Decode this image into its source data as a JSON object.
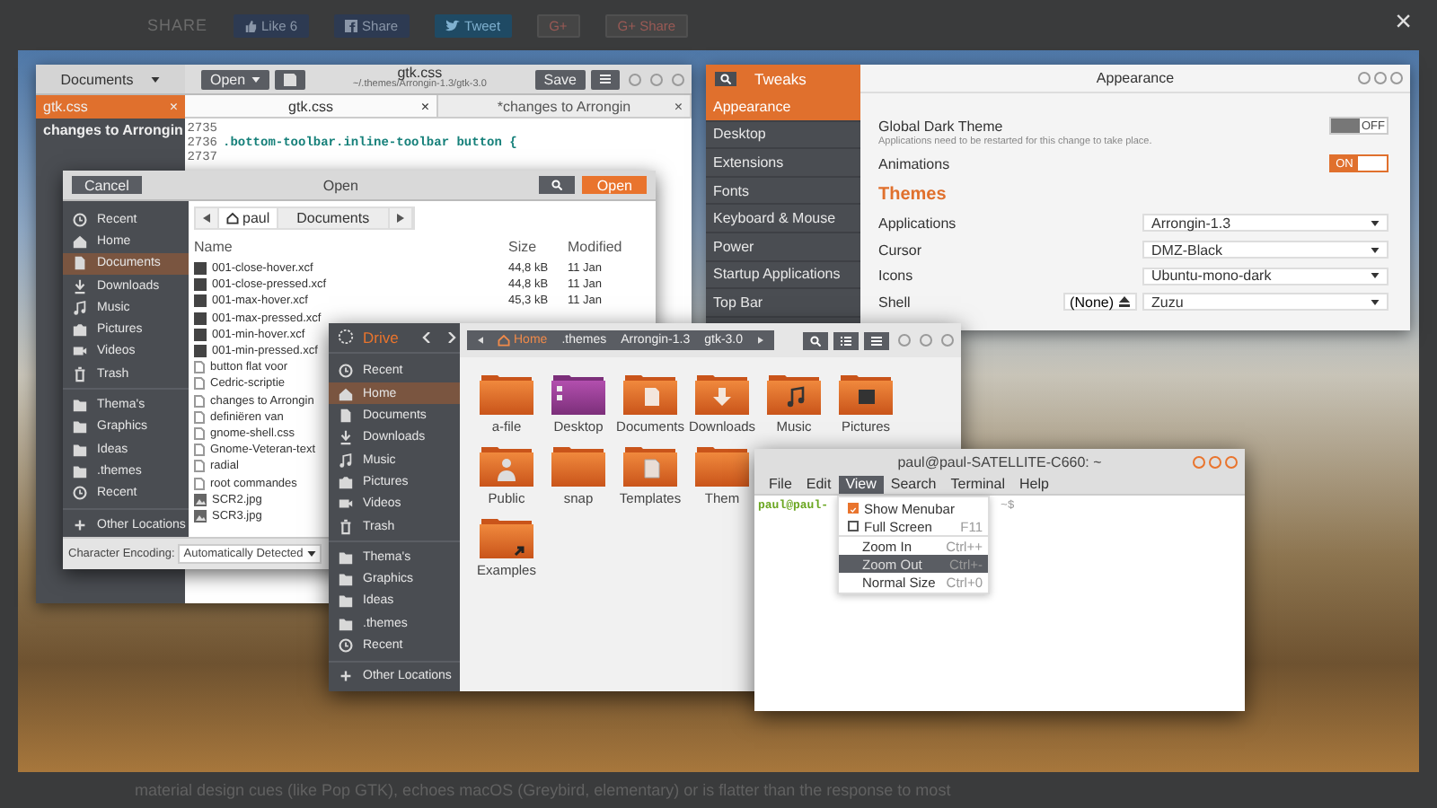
{
  "page": {
    "share_label": "SHARE",
    "share_buttons": [
      {
        "kind": "facebook-like",
        "label": "Like 6"
      },
      {
        "kind": "facebook",
        "label": "Share"
      },
      {
        "kind": "twitter",
        "label": "Tweet"
      },
      {
        "kind": "google",
        "label": "G+"
      },
      {
        "kind": "google",
        "label": "G+ Share"
      }
    ],
    "close": "×",
    "caption": "material design cues (like Pop GTK), echoes macOS (Greybird, elementary) or is flatter than the response to most"
  },
  "gedit": {
    "documents_button": "Documents",
    "open_button": "Open",
    "title": "gtk.css",
    "subtitle": "~/.themes/Arrongin-1.3/gtk-3.0",
    "save_button": "Save",
    "documents": [
      {
        "name": "gtk.css",
        "selected": true,
        "close": "×"
      },
      {
        "name": "changes to Arrongin",
        "selected": false
      }
    ],
    "tabs": [
      {
        "label": "gtk.css",
        "selected": true,
        "close": "×"
      },
      {
        "label": "*changes to Arrongin",
        "selected": false,
        "close": "×"
      }
    ],
    "lines": [
      {
        "number": "2735"
      },
      {
        "number": "2736",
        "code": ".bottom-toolbar.inline-toolbar button {"
      },
      {
        "number": "2737"
      }
    ]
  },
  "tweaks": {
    "title": "Tweaks",
    "page_title": "Appearance",
    "sidebar": [
      {
        "label": "Appearance",
        "selected": true
      },
      {
        "label": "Desktop",
        "selected": false
      },
      {
        "label": "Extensions",
        "selected": false
      },
      {
        "label": "Fonts",
        "selected": false
      },
      {
        "label": "Keyboard & Mouse",
        "selected": false
      },
      {
        "label": "Power",
        "selected": false
      },
      {
        "label": "Startup Applications",
        "selected": false
      },
      {
        "label": "Top Bar",
        "selected": false
      }
    ],
    "settings": [
      {
        "label": "Global Dark Theme",
        "note": "Applications need to be restarted for this change to take place.",
        "on": false,
        "state_label": "OFF"
      },
      {
        "label": "Animations",
        "on": true,
        "state_label": "ON"
      }
    ],
    "section": "Themes",
    "themes": [
      {
        "label": "Applications",
        "value": "Arrongin-1.3"
      },
      {
        "label": "Cursor",
        "value": "DMZ-Black"
      },
      {
        "label": "Icons",
        "value": "Ubuntu-mono-dark"
      },
      {
        "label": "Shell",
        "value": "Zuzu",
        "extra_button": "(None)"
      }
    ]
  },
  "file_chooser": {
    "cancel_button": "Cancel",
    "title": "Open",
    "open_button": "Open",
    "path": [
      {
        "label": "paul",
        "kind": "home",
        "selected": false
      },
      {
        "label": "Documents",
        "kind": "folder",
        "selected": true
      }
    ],
    "sidebar": [
      {
        "items": [
          {
            "kind": "recent",
            "label": "Recent",
            "selected": false
          },
          {
            "kind": "home",
            "label": "Home",
            "selected": false
          },
          {
            "kind": "documents",
            "label": "Documents",
            "selected": true
          },
          {
            "kind": "downloads",
            "label": "Downloads",
            "selected": false
          },
          {
            "kind": "music",
            "label": "Music",
            "selected": false
          },
          {
            "kind": "pictures",
            "label": "Pictures",
            "selected": false
          },
          {
            "kind": "videos",
            "label": "Videos",
            "selected": false
          },
          {
            "kind": "trash",
            "label": "Trash",
            "selected": false
          }
        ]
      },
      {
        "items": [
          {
            "kind": "folder",
            "label": "Thema's",
            "selected": false
          },
          {
            "kind": "folder",
            "label": "Graphics",
            "selected": false
          },
          {
            "kind": "folder",
            "label": "Ideas",
            "selected": false
          },
          {
            "kind": "folder",
            "label": ".themes",
            "selected": false
          },
          {
            "kind": "recent",
            "label": "Recent",
            "selected": false
          }
        ]
      },
      {
        "items": [
          {
            "kind": "other",
            "label": "Other Locations",
            "selected": false
          }
        ]
      }
    ],
    "columns": [
      "Name",
      "Size",
      "Modified"
    ],
    "files": [
      {
        "kind": "xcf",
        "name": "001-close-hover.xcf",
        "size": "44,8 kB",
        "modified": "11 Jan"
      },
      {
        "kind": "xcf",
        "name": "001-close-pressed.xcf",
        "size": "44,8 kB",
        "modified": "11 Jan"
      },
      {
        "kind": "xcf",
        "name": "001-max-hover.xcf",
        "size": "45,3 kB",
        "modified": "11 Jan"
      },
      {
        "kind": "xcf",
        "name": "001-max-pressed.xcf"
      },
      {
        "kind": "xcf",
        "name": "001-min-hover.xcf"
      },
      {
        "kind": "xcf",
        "name": "001-min-pressed.xcf"
      },
      {
        "kind": "text",
        "name": "button flat voor"
      },
      {
        "kind": "text",
        "name": "Cedric-scriptie"
      },
      {
        "kind": "text",
        "name": "changes to Arrongin"
      },
      {
        "kind": "text",
        "name": "definiëren van"
      },
      {
        "kind": "text",
        "name": "gnome-shell.css"
      },
      {
        "kind": "text",
        "name": "Gnome-Veteran-text"
      },
      {
        "kind": "text",
        "name": "radial"
      },
      {
        "kind": "text",
        "name": "root commandes"
      },
      {
        "kind": "jpg",
        "name": "SCR2.jpg"
      },
      {
        "kind": "jpg",
        "name": "SCR3.jpg"
      }
    ],
    "encoding_label": "Character Encoding:",
    "encoding_value": "Automatically Detected"
  },
  "files": {
    "location": "Drive",
    "path": [
      {
        "label": "Home",
        "kind": "home",
        "selected": true
      },
      {
        "label": ".themes",
        "kind": "folder",
        "selected": false
      },
      {
        "label": "Arrongin-1.3",
        "kind": "folder",
        "selected": false
      },
      {
        "label": "gtk-3.0",
        "kind": "folder",
        "selected": false
      }
    ],
    "sidebar": [
      {
        "items": [
          {
            "kind": "recent",
            "label": "Recent",
            "selected": false
          },
          {
            "kind": "home",
            "label": "Home",
            "selected": true
          },
          {
            "kind": "documents",
            "label": "Documents",
            "selected": false
          },
          {
            "kind": "downloads",
            "label": "Downloads",
            "selected": false
          },
          {
            "kind": "music",
            "label": "Music",
            "selected": false
          },
          {
            "kind": "pictures",
            "label": "Pictures",
            "selected": false
          },
          {
            "kind": "videos",
            "label": "Videos",
            "selected": false
          },
          {
            "kind": "trash",
            "label": "Trash",
            "selected": false
          }
        ]
      },
      {
        "items": [
          {
            "kind": "folder",
            "label": "Thema's",
            "selected": false
          },
          {
            "kind": "folder",
            "label": "Graphics",
            "selected": false
          },
          {
            "kind": "folder",
            "label": "Ideas",
            "selected": false
          },
          {
            "kind": "folder",
            "label": ".themes",
            "selected": false
          },
          {
            "kind": "recent",
            "label": "Recent",
            "selected": false
          }
        ]
      },
      {
        "items": [
          {
            "kind": "other",
            "label": "Other Locations",
            "selected": false
          }
        ]
      }
    ],
    "folder_rows": [
      {
        "items": [
          {
            "name": "a-file",
            "kind": "folder"
          },
          {
            "name": "Desktop",
            "kind": "desktop"
          },
          {
            "name": "Documents",
            "kind": "documents"
          },
          {
            "name": "Downloads",
            "kind": "downloads"
          },
          {
            "name": "Music",
            "kind": "music"
          },
          {
            "name": "Pictures",
            "kind": "pictures"
          }
        ]
      },
      {
        "items": [
          {
            "name": "Public",
            "kind": "public"
          },
          {
            "name": "snap",
            "kind": "folder"
          },
          {
            "name": "Templates",
            "kind": "templates"
          },
          {
            "name": "Them",
            "kind": "folder"
          }
        ]
      },
      {
        "items": [
          {
            "name": "Examples",
            "kind": "link"
          }
        ]
      }
    ]
  },
  "terminal": {
    "title": "paul@paul-SATELLITE-C660: ~",
    "menus": [
      {
        "label": "File",
        "selected": false
      },
      {
        "label": "Edit",
        "selected": false
      },
      {
        "label": "View",
        "selected": true
      },
      {
        "label": "Search",
        "selected": false
      },
      {
        "label": "Terminal",
        "selected": false
      },
      {
        "label": "Help",
        "selected": false
      }
    ],
    "prompt_user": "paul@paul-",
    "prompt_tail": "~$",
    "view_menu": [
      {
        "kind": "check",
        "label": "Show Menubar",
        "checked": true,
        "selected": false
      },
      {
        "kind": "check",
        "label": "Full Screen",
        "shortcut": "F11",
        "checked": false,
        "selected": false
      },
      {
        "kind": "action",
        "label": "Zoom In",
        "shortcut": "Ctrl++",
        "selected": false
      },
      {
        "kind": "action",
        "label": "Zoom Out",
        "shortcut": "Ctrl+-",
        "selected": true
      },
      {
        "kind": "action",
        "label": "Normal Size",
        "shortcut": "Ctrl+0",
        "selected": false
      }
    ]
  }
}
